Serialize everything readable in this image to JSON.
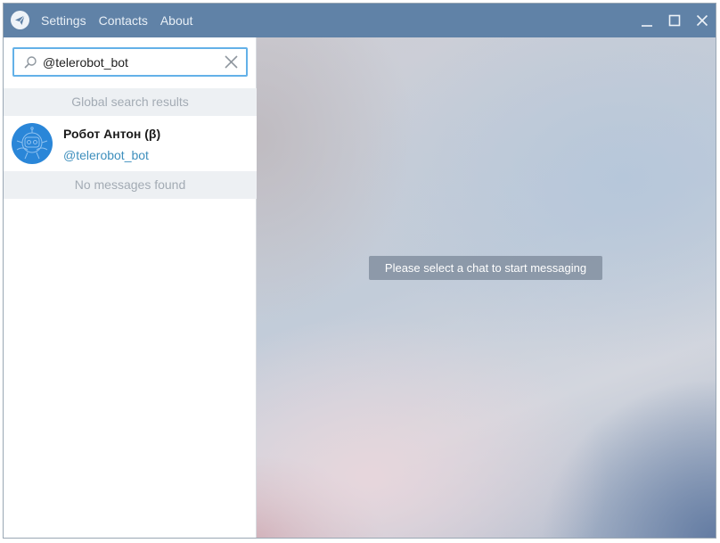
{
  "titlebar": {
    "menu": [
      {
        "label": "Settings"
      },
      {
        "label": "Contacts"
      },
      {
        "label": "About"
      }
    ]
  },
  "search": {
    "value": "@telerobot_bot"
  },
  "sidebar": {
    "global_header": "Global search results",
    "result": {
      "name": "Робот Антон (β)",
      "username": "@telerobot_bot"
    },
    "messages_header": "No messages found"
  },
  "main": {
    "empty_message": "Please select a chat to start messaging"
  },
  "colors": {
    "titlebar": "#6082a7",
    "search_border": "#63b1e8",
    "username": "#3e8fbd",
    "avatar": "#2a86d8"
  }
}
